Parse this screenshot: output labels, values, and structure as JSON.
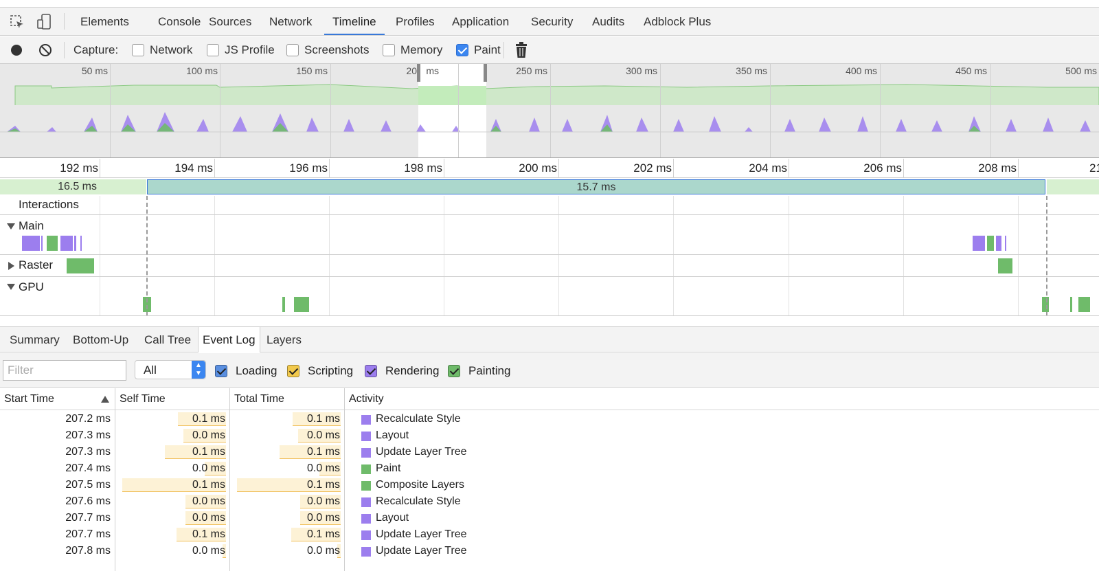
{
  "toolbar": {
    "tabs": [
      "Elements",
      "Console",
      "Sources",
      "Network",
      "Timeline",
      "Profiles",
      "Application",
      "Security",
      "Audits",
      "Adblock Plus"
    ],
    "selected_tab": "Timeline"
  },
  "capture": {
    "label": "Capture:",
    "options": [
      {
        "label": "Network",
        "checked": false
      },
      {
        "label": "JS Profile",
        "checked": false
      },
      {
        "label": "Screenshots",
        "checked": false
      },
      {
        "label": "Memory",
        "checked": false
      },
      {
        "label": "Paint",
        "checked": true
      }
    ]
  },
  "overview": {
    "ticks": [
      "50 ms",
      "100 ms",
      "150 ms",
      "20",
      "ms",
      "250 ms",
      "300 ms",
      "350 ms",
      "400 ms",
      "450 ms",
      "500 ms"
    ]
  },
  "ruler": {
    "ticks": [
      "192 ms",
      "194 ms",
      "196 ms",
      "198 ms",
      "200 ms",
      "202 ms",
      "204 ms",
      "206 ms",
      "208 ms",
      "21"
    ]
  },
  "frames": {
    "prev_frame": "16.5 ms",
    "selected_frame": "15.7 ms"
  },
  "tracks": {
    "interactions": "Interactions",
    "main": "Main",
    "raster": "Raster",
    "gpu": "GPU"
  },
  "bottom_tabs": {
    "tabs": [
      "Summary",
      "Bottom-Up",
      "Call Tree",
      "Event Log",
      "Layers"
    ],
    "selected": "Event Log"
  },
  "filter": {
    "placeholder": "Filter",
    "level": "All",
    "categories": [
      {
        "label": "Loading",
        "color": "#5a8fe0"
      },
      {
        "label": "Scripting",
        "color": "#f2c94c"
      },
      {
        "label": "Rendering",
        "color": "#9c7eee"
      },
      {
        "label": "Painting",
        "color": "#6fbb6a"
      }
    ]
  },
  "table": {
    "headers": [
      "Start Time",
      "Self Time",
      "Total Time",
      "Activity"
    ],
    "rows": [
      {
        "start": "207.2 ms",
        "self": "0.1 ms",
        "total": "0.1 ms",
        "activity": "Recalculate Style",
        "kind": "rendering",
        "bar": 0.45
      },
      {
        "start": "207.3 ms",
        "self": "0.0 ms",
        "total": "0.0 ms",
        "activity": "Layout",
        "kind": "rendering",
        "bar": 0.4
      },
      {
        "start": "207.3 ms",
        "self": "0.1 ms",
        "total": "0.1 ms",
        "activity": "Update Layer Tree",
        "kind": "rendering",
        "bar": 0.57
      },
      {
        "start": "207.4 ms",
        "self": "0.0 ms",
        "total": "0.0 ms",
        "activity": "Paint",
        "kind": "painting",
        "bar": 0.2
      },
      {
        "start": "207.5 ms",
        "self": "0.1 ms",
        "total": "0.1 ms",
        "activity": "Composite Layers",
        "kind": "painting",
        "bar": 0.97
      },
      {
        "start": "207.6 ms",
        "self": "0.0 ms",
        "total": "0.0 ms",
        "activity": "Recalculate Style",
        "kind": "rendering",
        "bar": 0.38
      },
      {
        "start": "207.7 ms",
        "self": "0.0 ms",
        "total": "0.0 ms",
        "activity": "Layout",
        "kind": "rendering",
        "bar": 0.38
      },
      {
        "start": "207.7 ms",
        "self": "0.1 ms",
        "total": "0.1 ms",
        "activity": "Update Layer Tree",
        "kind": "rendering",
        "bar": 0.46
      },
      {
        "start": "207.8 ms",
        "self": "0.0 ms",
        "total": "0.0 ms",
        "activity": "Update Layer Tree",
        "kind": "rendering",
        "bar": 0.03
      }
    ]
  },
  "colors": {
    "rendering": "#9c7eee",
    "painting": "#6fbb6a",
    "accent": "#3879d9"
  },
  "icons": [
    "inspect-icon",
    "device-mode-icon",
    "record-icon",
    "clear-icon",
    "trash-icon"
  ]
}
